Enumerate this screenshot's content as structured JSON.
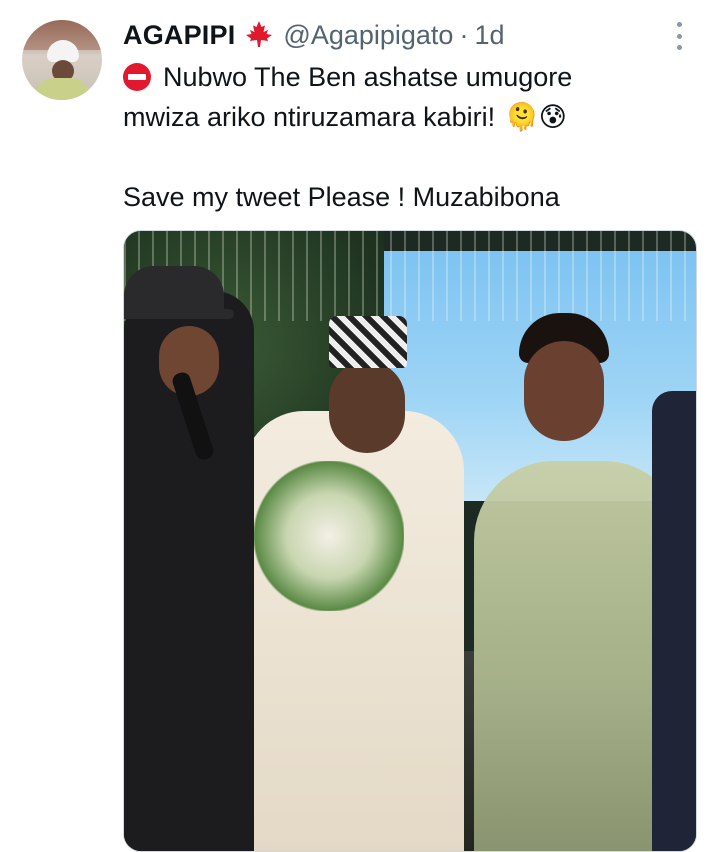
{
  "tweet": {
    "author_name": "AGAPIPI",
    "author_handle": "@Agapipigato",
    "separator": "·",
    "timestamp": "1d",
    "lines": [
      "Nubwo The Ben ashatse umugore",
      "mwiza ariko ntiruzamara kabiri!",
      "Save my tweet Please ! Muzabibona"
    ],
    "emojis": {
      "leaf": "maple-leaf-icon",
      "no_entry": "no-entry-icon",
      "end_emojis": "🫠😰"
    }
  },
  "colors": {
    "text": "#0f1419",
    "secondary": "#536471",
    "leaf": "#e0192f",
    "border": "#cfd9de"
  }
}
